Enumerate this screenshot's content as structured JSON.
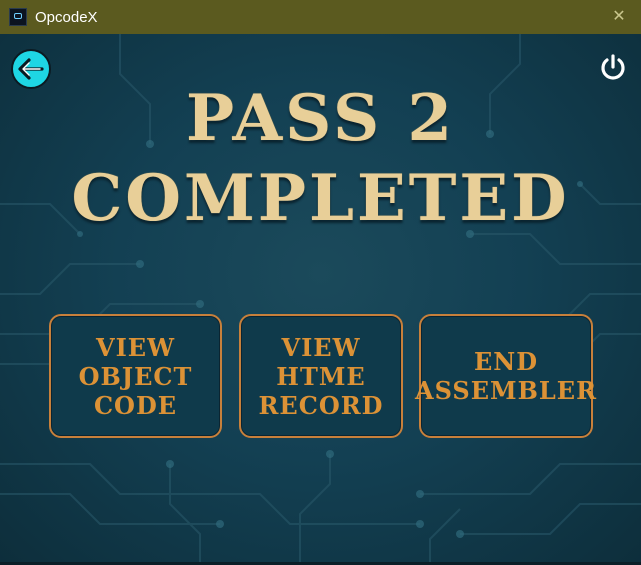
{
  "window": {
    "title": "OpcodeX",
    "close_glyph": "✕"
  },
  "header": {
    "back_icon": "arrow-left-icon",
    "power_icon": "power-icon"
  },
  "headline": {
    "line1": "PASS 2",
    "line2": "COMPLETED"
  },
  "actions": [
    {
      "lines": [
        "VIEW",
        "OBJECT",
        "CODE"
      ]
    },
    {
      "lines": [
        "VIEW",
        "HTME",
        "RECORD"
      ]
    },
    {
      "lines": [
        "END",
        "ASSEMBLER"
      ]
    }
  ],
  "colors": {
    "titlebar": "#5b5a1f",
    "background": "#123645",
    "headline": "#e8cf98",
    "button_border": "#c8803b",
    "button_text": "#dc9236",
    "back_button": "#1ed6e4"
  }
}
